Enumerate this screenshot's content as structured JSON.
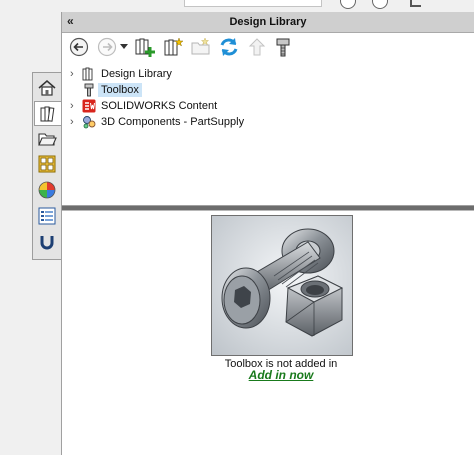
{
  "panel": {
    "title": "Design Library",
    "collapse_glyph": "«"
  },
  "toolbar": {
    "items": [
      {
        "name": "back-icon"
      },
      {
        "name": "forward-icon"
      },
      {
        "name": "dropdown-arrow-icon"
      },
      {
        "name": "add-to-library-icon"
      },
      {
        "name": "add-file-location-icon"
      },
      {
        "name": "create-new-folder-icon"
      },
      {
        "name": "refresh-icon"
      },
      {
        "name": "up-one-level-icon"
      },
      {
        "name": "toolbox-bolt-icon"
      }
    ]
  },
  "tree": {
    "items": [
      {
        "label": "Design Library",
        "icon": "design-library-icon",
        "expandable": true,
        "selected": false
      },
      {
        "label": "Toolbox",
        "icon": "toolbox-icon",
        "expandable": false,
        "selected": true
      },
      {
        "label": "SOLIDWORKS Content",
        "icon": "solidworks-content-icon",
        "expandable": true,
        "selected": false
      },
      {
        "label": "3D Components - PartSupply",
        "icon": "partsupply-icon",
        "expandable": true,
        "selected": false
      }
    ]
  },
  "tabs": [
    {
      "name": "home-tab",
      "icon": "home-icon"
    },
    {
      "name": "design-library-tab",
      "icon": "books-icon"
    },
    {
      "name": "file-explorer-tab",
      "icon": "folder-icon"
    },
    {
      "name": "view-palette-tab",
      "icon": "view-palette-icon"
    },
    {
      "name": "appearances-tab",
      "icon": "appearances-sphere-icon"
    },
    {
      "name": "custom-properties-tab",
      "icon": "properties-list-icon"
    },
    {
      "name": "magnet-tab",
      "icon": "magnet-icon"
    }
  ],
  "preview": {
    "image": "hex-bolt-and-nut",
    "note": "Toolbox is not added in",
    "link": "Add in now",
    "link_color": "#197a1c"
  }
}
